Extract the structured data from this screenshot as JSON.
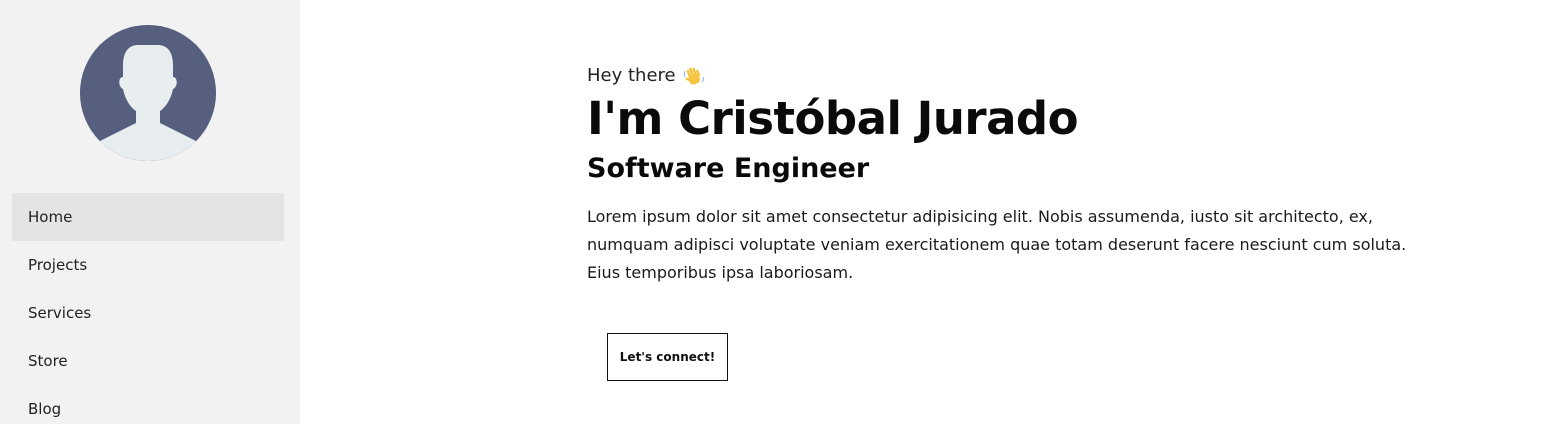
{
  "sidebar": {
    "avatar_icon": "person-silhouette-icon",
    "items": [
      {
        "label": "Home",
        "active": true
      },
      {
        "label": "Projects",
        "active": false
      },
      {
        "label": "Services",
        "active": false
      },
      {
        "label": "Store",
        "active": false
      },
      {
        "label": "Blog",
        "active": false
      }
    ]
  },
  "hero": {
    "greeting": "Hey there",
    "greeting_icon": "waving-hand-icon",
    "title": "I'm Cristóbal Jurado",
    "subtitle": "Software Engineer",
    "bio": "Lorem ipsum dolor sit amet consectetur adipisicing elit. Nobis assumenda, iusto sit architecto, ex, numquam adipisci voluptate veniam exercitationem quae totam deserunt facere nesciunt cum soluta. Eius temporibus ipsa laboriosam.",
    "cta_label": "Let's connect!"
  },
  "colors": {
    "sidebar_bg": "#f2f2f2",
    "nav_active_bg": "#e4e4e4",
    "avatar_bg": "#56607e",
    "avatar_figure": "#e8edef"
  }
}
